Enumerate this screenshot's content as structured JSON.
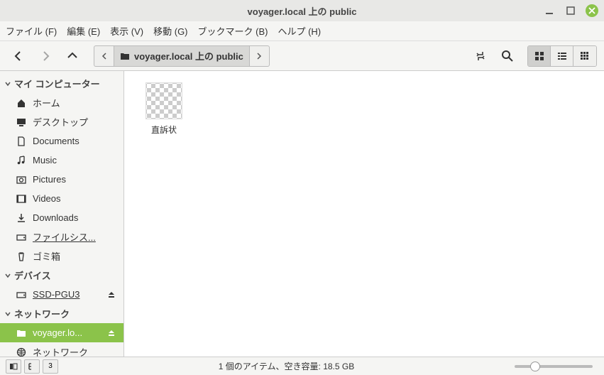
{
  "window": {
    "title": "voyager.local 上の public"
  },
  "menu": {
    "file": "ファイル (F)",
    "edit": "編集 (E)",
    "view": "表示 (V)",
    "go": "移動 (G)",
    "bookmarks": "ブックマーク (B)",
    "help": "ヘルプ (H)"
  },
  "pathbar": {
    "location": "voyager.local 上の public"
  },
  "sidebar": {
    "sections": {
      "computer": "マイ コンピューター",
      "devices": "デバイス",
      "network": "ネットワーク"
    },
    "computer_items": {
      "home": "ホーム",
      "desktop": "デスクトップ",
      "documents": "Documents",
      "music": "Music",
      "pictures": "Pictures",
      "videos": "Videos",
      "downloads": "Downloads",
      "filesystem": "ファイルシス...",
      "trash": "ゴミ箱"
    },
    "device_items": {
      "ssd": "SSD-PGU3"
    },
    "network_items": {
      "voyager": "voyager.lo...",
      "network": "ネットワーク"
    }
  },
  "files": [
    {
      "name": "直訴状"
    }
  ],
  "statusbar": {
    "text": "1 個のアイテム、空き容量: 18.5 GB",
    "btn3": "3"
  }
}
